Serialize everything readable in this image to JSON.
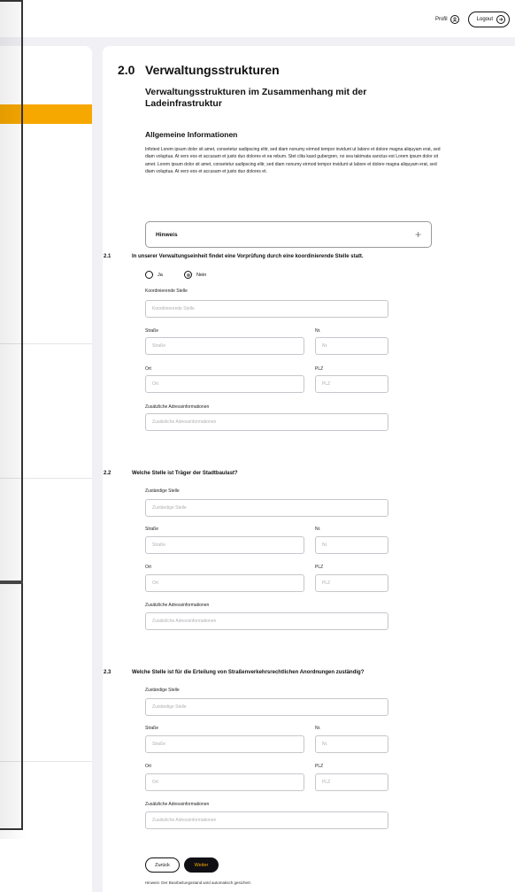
{
  "header": {
    "profile_label": "Profil",
    "profile_icon": "user-circle-icon",
    "logout_label": "Logout",
    "logout_icon": "arrow-right-circle-icon"
  },
  "colors": {
    "accent": "#f6a800",
    "dark": "#0f0f14",
    "page_bg": "#f1f1f5"
  },
  "section": {
    "number": "2.0",
    "title": "Verwaltungsstrukturen",
    "subtitle": "Verwaltungsstrukturen im Zusammenhang mit der Ladeinfrastruktur",
    "info_heading": "Allgemeine Informationen",
    "info_text": "Infotext Lorem ipsum dolor sit amet, consetetur sadipscing elitr, sed diam nonumy eirmod tempor invidunt ut labore et dolore magna aliquyam erat, sed diam voluptua. At vero eos et accusam et justo duo dolores et ea rebum. Stet clita kasd gubergren, no sea takimata sanctus est Lorem ipsum dolor sit amet. Lorem ipsum dolor sit amet, consetetur sadipscing elitr, sed diam nonumy eirmod tempor invidunt ut labore et dolore magna aliquyam erat, sed diam voluptua. At vero eos et accusam et justo duo dolores et.",
    "hinweis_label": "Hinweis",
    "hinweis_icon": "+"
  },
  "q1": {
    "number": "2.1",
    "text": "In unserer Verwaltungseinheit findet eine Vorprüfung durch eine koordinierende Stelle statt.",
    "option_yes": "Ja",
    "option_no": "Nein",
    "selected": "Nein",
    "field1_label": "Koordinierende Stelle",
    "field1_placeholder": "Koordinierende Stelle",
    "street_label": "Straße",
    "street_placeholder": "Straße",
    "nr_label": "Nr.",
    "nr_placeholder": "Nr.",
    "ort_label": "Ort",
    "ort_placeholder": "Ort",
    "plz_label": "PLZ",
    "plz_placeholder": "PLZ",
    "addr_label": "Zusätzliche Adressinformationen",
    "addr_placeholder": "Zusätzliche Adressinformationen"
  },
  "q2": {
    "number": "2.2",
    "text": "Welche Stelle ist Träger der Stadtbaulast?",
    "field1_label": "Zuständige Stelle",
    "field1_placeholder": "Zuständige Stelle",
    "street_label": "Straße",
    "street_placeholder": "Straße",
    "nr_label": "Nr.",
    "nr_placeholder": "Nr.",
    "ort_label": "Ort",
    "ort_placeholder": "Ort",
    "plz_label": "PLZ",
    "plz_placeholder": "PLZ",
    "addr_label": "Zusätzliche Adressinformationen",
    "addr_placeholder": "Zusätzliche Adressinformationen"
  },
  "q3": {
    "number": "2.3",
    "text": "Welche Stelle ist für die Erteilung von Straßenverkehrsrechtlichen Anordnungen zuständig?",
    "field1_label": "Zuständige Stelle",
    "field1_placeholder": "Zuständige Stelle",
    "street_label": "Straße",
    "street_placeholder": "Straße",
    "nr_label": "Nr.",
    "nr_placeholder": "Nr.",
    "ort_label": "Ort",
    "ort_placeholder": "Ort",
    "plz_label": "PLZ",
    "plz_placeholder": "PLZ",
    "addr_label": "Zusätzliche Adressinformationen",
    "addr_placeholder": "Zusätzliche Adressinformationen"
  },
  "footer": {
    "back_label": "Zurück",
    "next_label": "Weiter",
    "autosave_note": "Hinweis: Der Bearbeitungsstand wird automatisch gesichert."
  }
}
